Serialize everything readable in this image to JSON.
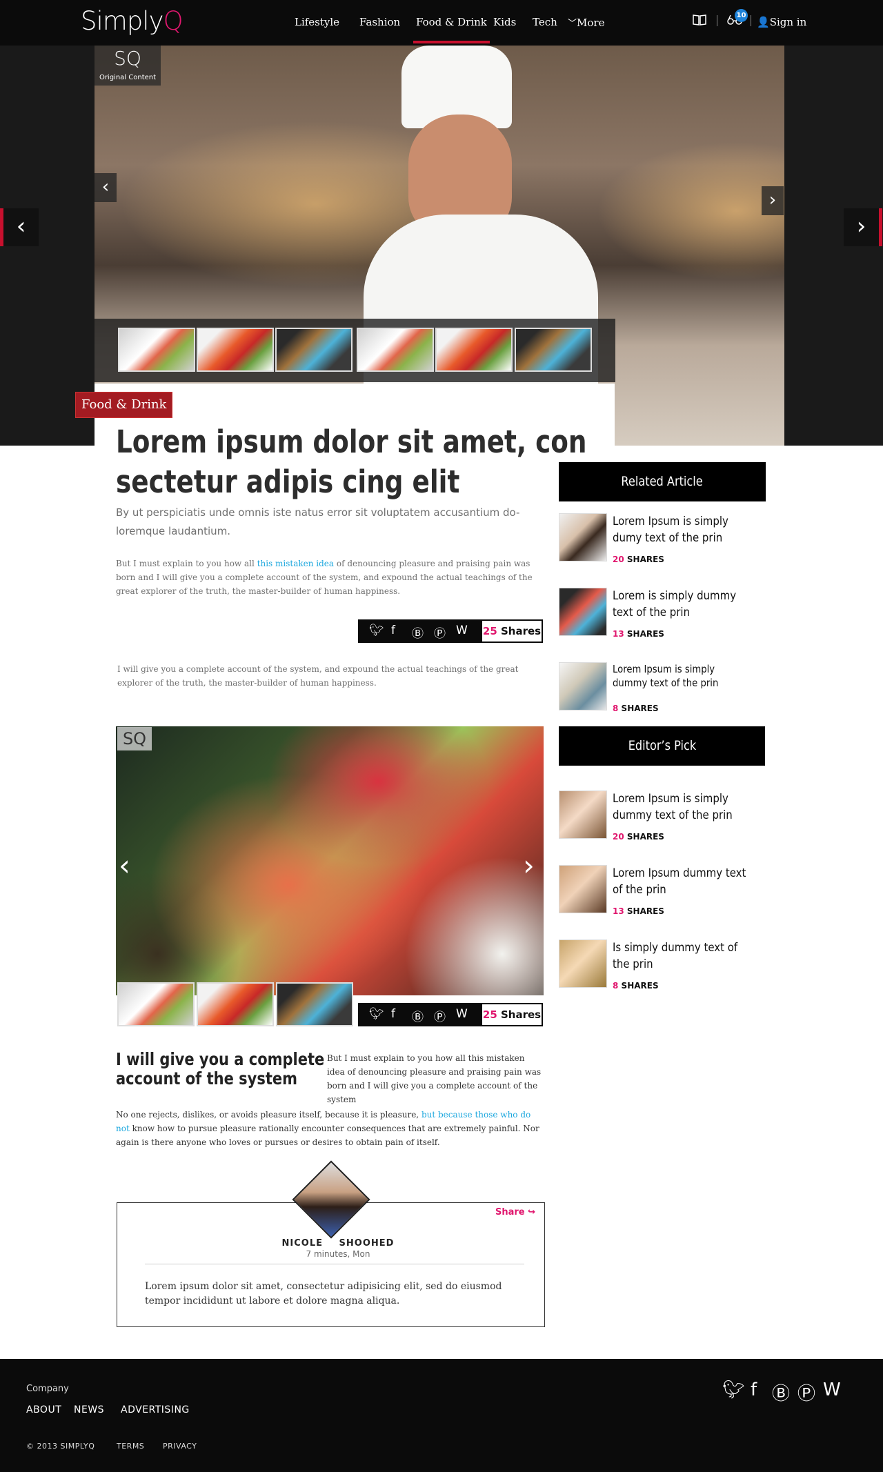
{
  "nav": {
    "logo_main": "Simply",
    "logo_q": "Q",
    "items": [
      "Lifestyle",
      "Fashion",
      "Food & Drink",
      "Kids",
      "Tech",
      "More"
    ],
    "badge": "10",
    "sign_in": "Sign in"
  },
  "hero": {
    "badge_logo": "SQ",
    "badge_text": "Original Content"
  },
  "article": {
    "category": "Food & Drink",
    "headline_line1": "Lorem ipsum dolor sit amet, con",
    "headline_line2": "sectetur adipis cing elit",
    "subhead": "By ut perspiciatis unde omnis iste natus error sit voluptatem accusantium do-loremque laudantium.",
    "p1_pre": "But I must explain to you how all ",
    "p1_link": "this mistaken idea",
    "p1_post": " of denouncing pleasure and praising pain was born and I will give you a complete account of the system, and expound the actual teachings of the great explorer of the truth, the master-builder of human happiness.",
    "p2": "I will give you a complete account of the system, and expound the actual teachings of the great explorer of the truth, the master-builder of human happiness.",
    "shares_count": "25",
    "shares_label": "Shares",
    "section_heading": "I will give you a complete account of the system",
    "section_right": "But I must explain to you how all this mistaken idea of denouncing pleasure and praising pain was born and I will give you a complete account of the system",
    "section_pre": "No one rejects, dislikes, or avoids pleasure itself, because it is pleasure, ",
    "section_link": "but because those who do not",
    "section_post": " know how to pursue pleasure rationally encounter consequences that are extremely painful. Nor again is there anyone who loves or pursues or desires to obtain pain of itself."
  },
  "author": {
    "share": "Share",
    "name": "NICOLE SHOOHED",
    "time": "7 minutes, Mon",
    "quote": "Lorem ipsum dolor sit amet, consectetur adipisicing elit, sed do eiusmod tempor incididunt ut labore et dolore magna aliqua."
  },
  "sidebar": {
    "related_heading": "Related Article",
    "related": [
      {
        "title": "Lorem Ipsum is simply dumy text of the prin",
        "count": "20",
        "label": "SHARES"
      },
      {
        "title": "Lorem  is simply dummy text of the prin",
        "count": "13",
        "label": "SHARES"
      },
      {
        "title": "Lorem Ipsum is simply dummy text of the prin",
        "count": "8",
        "label": "SHARES"
      }
    ],
    "editors_heading": "Editor’s Pick",
    "editors": [
      {
        "title": "Lorem Ipsum is simply dummy text of the prin",
        "count": "20",
        "label": "SHARES"
      },
      {
        "title": "Lorem Ipsum dummy text of the prin",
        "count": "13",
        "label": "SHARES"
      },
      {
        "title": "Is simply dummy text of the prin",
        "count": "8",
        "label": "SHARES"
      }
    ]
  },
  "footer": {
    "company": "Company",
    "links": [
      "ABOUT",
      "NEWS",
      "ADVERTISING"
    ],
    "copyright": "© 2013 SIMPLYQ",
    "terms": "TERMS",
    "privacy": "PRIVACY"
  },
  "colors": {
    "accent": "#e0176e",
    "category_red": "#a31b22",
    "link_blue": "#1ba7de",
    "badge_blue": "#1e82d8"
  },
  "icons": [
    "book-icon",
    "glasses-icon",
    "user-icon",
    "twitter-icon",
    "facebook-icon",
    "blogger-icon",
    "pinterest-icon",
    "wordpress-icon",
    "arrow-left-icon",
    "arrow-right-icon",
    "chevron-down-icon",
    "share-arrow-icon"
  ]
}
